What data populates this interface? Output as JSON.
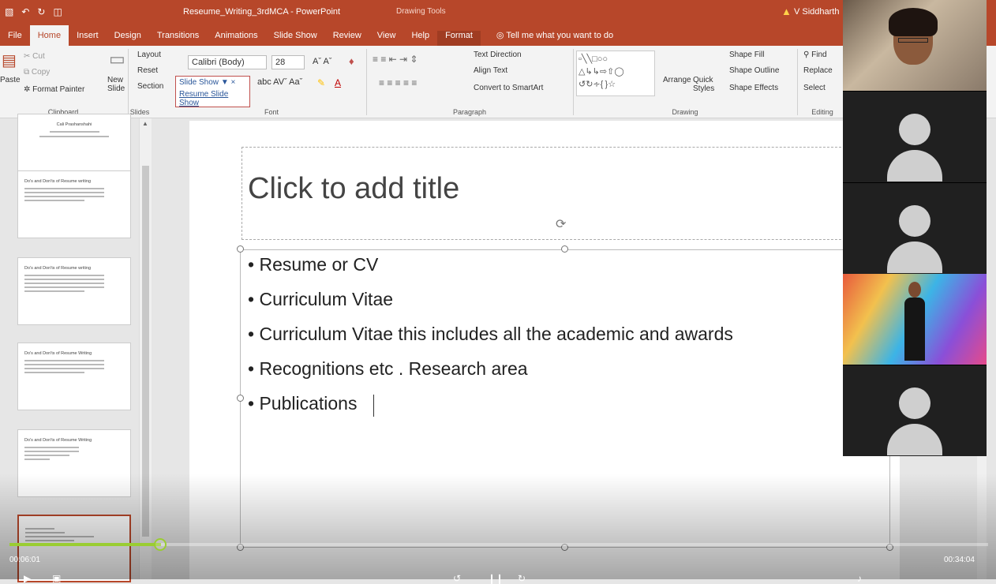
{
  "titlebar": {
    "doc_title": "Reseume_Writing_3rdMCA - PowerPoint",
    "context_tab_group": "Drawing Tools",
    "user_name": "V Siddharth"
  },
  "tabs": [
    {
      "label": "File"
    },
    {
      "label": "Home"
    },
    {
      "label": "Insert"
    },
    {
      "label": "Design"
    },
    {
      "label": "Transitions"
    },
    {
      "label": "Animations"
    },
    {
      "label": "Slide Show"
    },
    {
      "label": "Review"
    },
    {
      "label": "View"
    },
    {
      "label": "Help"
    },
    {
      "label": "Format"
    }
  ],
  "tell_me": "Tell me what you want to do",
  "ribbon": {
    "clipboard": {
      "paste": "Paste",
      "cut": "Cut",
      "copy": "Copy",
      "format_painter": "Format Painter",
      "label": "Clipboard"
    },
    "slides": {
      "new_slide": "New Slide",
      "layout": "Layout",
      "reset": "Reset",
      "section": "Section",
      "label": "Slides"
    },
    "font": {
      "font_name": "Calibri (Body)",
      "font_size": "28",
      "label": "Font"
    },
    "paragraph": {
      "text_direction": "Text Direction",
      "align_text": "Align Text",
      "convert_smartart": "Convert to SmartArt",
      "label": "Paragraph"
    },
    "drawing": {
      "arrange": "Arrange",
      "quick_styles": "Quick Styles",
      "shape_fill": "Shape Fill",
      "shape_outline": "Shape Outline",
      "shape_effects": "Shape Effects",
      "label": "Drawing"
    },
    "editing": {
      "find": "Find",
      "replace": "Replace",
      "select": "Select",
      "label": "Editing"
    }
  },
  "popup": {
    "header": "Slide Show",
    "item": "Resume Slide Show"
  },
  "thumbnails": [
    {
      "title": "Cali Prashanshahi"
    },
    {
      "title": "Do's and Don'ts of Resume writing"
    },
    {
      "title": "Do's and Don'ts of Resume writing"
    },
    {
      "title": "Do's and Don'ts of Resume Writing"
    },
    {
      "title": "Do's and Don'ts of Resume Writing"
    },
    {
      "title": ""
    }
  ],
  "slide": {
    "title_placeholder": "Click to add title",
    "bullets": [
      "Resume or CV",
      "Curriculum Vitae",
      "Curriculum Vitae this includes all the academic and awards",
      "Recognitions etc . Research area",
      "Publications"
    ]
  },
  "player": {
    "current_time": "00:06:01",
    "total_time": "00:34:04",
    "progress": 0.155
  }
}
